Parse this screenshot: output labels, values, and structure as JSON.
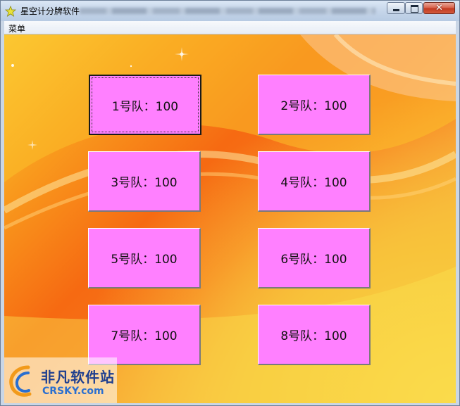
{
  "window": {
    "title": "星空计分牌软件",
    "buttons": {
      "minimize": "minimize",
      "maximize": "maximize",
      "close": "✕"
    }
  },
  "menu": {
    "items": [
      {
        "label": "菜单"
      }
    ]
  },
  "teams": [
    {
      "label": "1号队：100",
      "focused": true
    },
    {
      "label": "2号队：100",
      "focused": false
    },
    {
      "label": "3号队：100",
      "focused": false
    },
    {
      "label": "4号队：100",
      "focused": false
    },
    {
      "label": "5号队：100",
      "focused": false
    },
    {
      "label": "6号队：100",
      "focused": false
    },
    {
      "label": "7号队：100",
      "focused": false
    },
    {
      "label": "8号队：100",
      "focused": false
    }
  ],
  "watermark": {
    "name_cn": "非凡软件站",
    "name_en": "CRSKY.com"
  },
  "colors": {
    "button_fill": "#ff80ff",
    "background_accent": "#f66a12"
  },
  "icons": {
    "app": "star-icon",
    "minimize": "minimize-icon",
    "maximize": "maximize-icon",
    "close": "close-icon"
  }
}
